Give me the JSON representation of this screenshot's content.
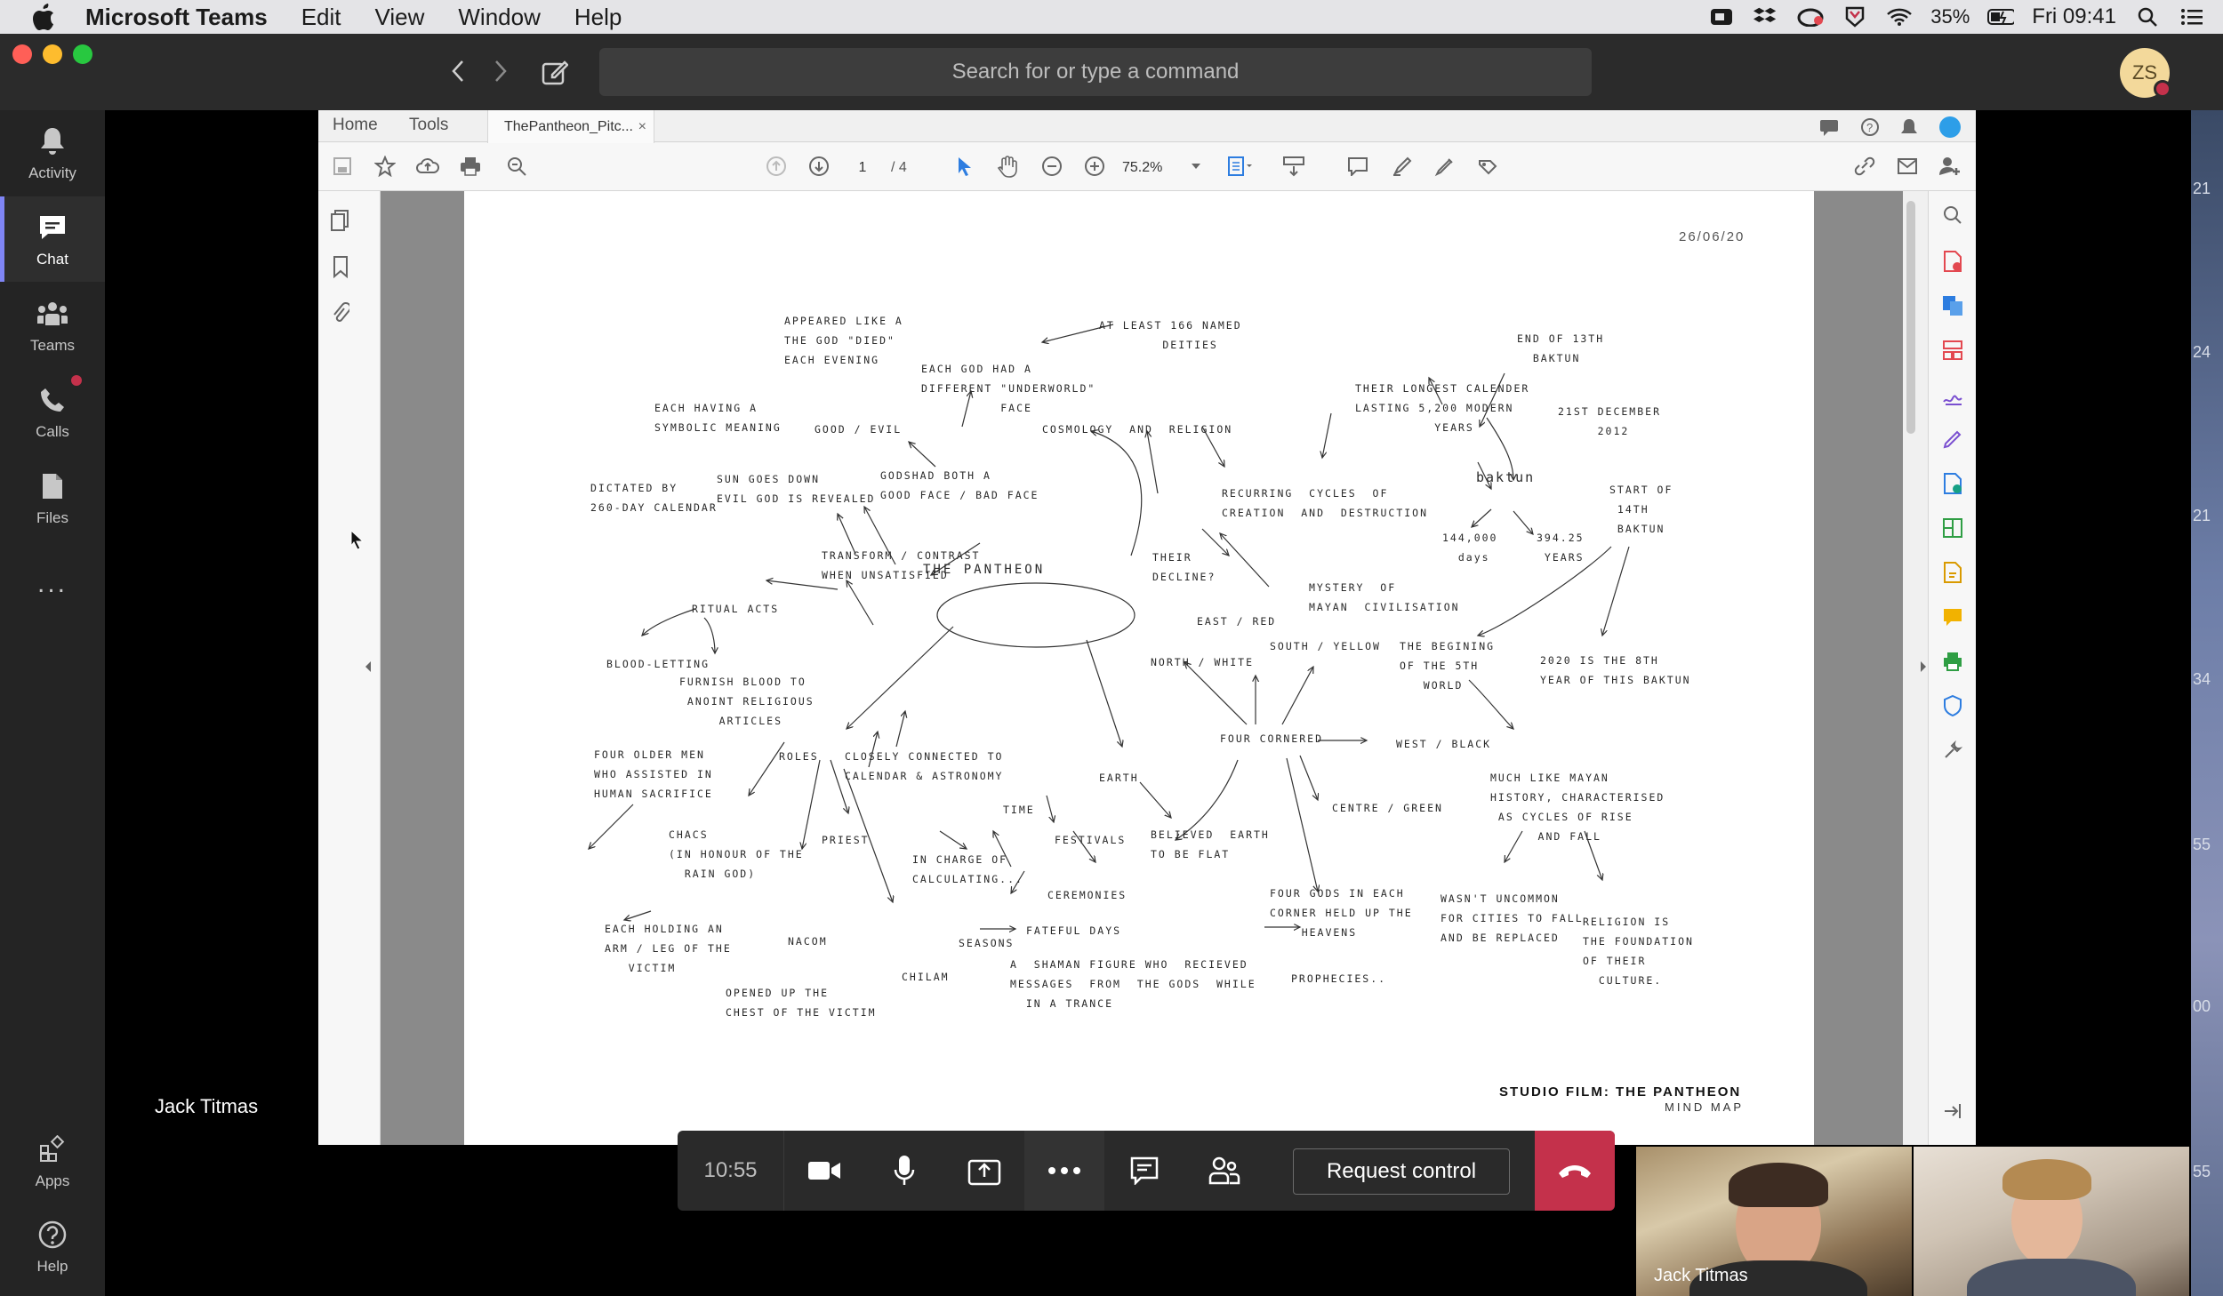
{
  "menubar": {
    "app_name": "Microsoft Teams",
    "menus": [
      "Edit",
      "View",
      "Window",
      "Help"
    ],
    "battery": "35%",
    "clock": "Fri 09:41"
  },
  "teams": {
    "search_placeholder": "Search for or type a command",
    "avatar_initials": "ZS",
    "rail": {
      "activity": "Activity",
      "chat": "Chat",
      "teams": "Teams",
      "calls": "Calls",
      "files": "Files",
      "more": "...",
      "apps": "Apps",
      "help": "Help"
    },
    "presenter_name": "Jack Titmas"
  },
  "acrobat": {
    "tabs": {
      "home": "Home",
      "tools": "Tools",
      "doc": "ThePantheon_Pitc...",
      "close": "×"
    },
    "page_current": "1",
    "page_total": "/ 4",
    "zoom": "75.2%"
  },
  "pdf": {
    "date": "26/06/20",
    "title": "STUDIO FILM: THE PANTHEON",
    "subtitle": "MIND MAP",
    "center": "THE PANTHEON",
    "nodes": {
      "n1": "APPEARED LIKE A\nTHE GOD \"DIED\"\nEACH EVENING",
      "n2": "AT LEAST 166 NAMED\n        DEITIES",
      "n3": "EACH GOD HAD A\nDIFFERENT \"UNDERWORLD\"\n          FACE",
      "n4": "EACH HAVING A\nSYMBOLIC MEANING",
      "n5": "GOOD / EVIL",
      "n6": "COSMOLOGY  AND  RELIGION",
      "n7": "SUN GOES DOWN\nEVIL GOD IS REVEALED",
      "n8": "GODSHAD BOTH A\nGOOD FACE / BAD FACE",
      "n9": "DICTATED BY\n260-DAY CALENDAR",
      "n10": "TRANSFORM / CONTRAST\nWHEN UNSATISFIED",
      "n11": "RITUAL ACTS",
      "n12": "BLOOD-LETTING",
      "n13": "FURNISH BLOOD TO\n ANOINT RELIGIOUS\n     ARTICLES",
      "n14": "END OF 13TH\n  BAKTUN",
      "n15": "THEIR LONGEST CALENDER\nLASTING 5,200 MODERN\n          YEARS",
      "n16": "21ST DECEMBER\n     2012",
      "n17": "RECURRING  CYCLES  OF\nCREATION  AND  DESTRUCTION",
      "n18": "baktun",
      "n19": "START OF\n 14TH\n BAKTUN",
      "n20": "144,000\n  days",
      "n21": "394.25\n YEARS",
      "n22": "THEIR\nDECLINE?",
      "n23": "MYSTERY  OF\nMAYAN  CIVILISATION",
      "n24": "EAST / RED",
      "n25": "SOUTH / YELLOW",
      "n26": "NORTH / WHITE",
      "n27": "THE BEGINING\nOF THE 5TH\n   WORLD",
      "n28": "2020 IS THE 8TH\nYEAR OF THIS BAKTUN",
      "n29": "FOUR CORNERED",
      "n30": "WEST / BLACK",
      "n31": "FOUR OLDER MEN\nWHO ASSISTED IN\nHUMAN SACRIFICE",
      "n32": "ROLES",
      "n33": "CLOSELY CONNECTED TO\nCALENDAR & ASTRONOMY",
      "n34": "EARTH",
      "n35": "MUCH LIKE MAYAN\nHISTORY, CHARACTERISED\n AS CYCLES OF RISE\n      AND FALL",
      "n36": "CENTRE / GREEN",
      "n37": "CHACS\n(IN HONOUR OF THE\n  RAIN GOD)",
      "n38": "PRIEST",
      "n39": "TIME",
      "n40": "FESTIVALS",
      "n41": "BELIEVED  EARTH\nTO BE FLAT",
      "n42": "IN CHARGE OF\nCALCULATING...",
      "n43": "CEREMONIES",
      "n44": "FOUR GODS IN EACH\nCORNER HELD UP THE\n    HEAVENS",
      "n45": "WASN'T UNCOMMON\nFOR CITIES TO FALL\nAND BE REPLACED",
      "n46": "RELIGION IS\nTHE FOUNDATION\nOF THEIR\n  CULTURE.",
      "n47": "EACH HOLDING AN\nARM / LEG OF THE\n   VICTIM",
      "n48": "NACOM",
      "n49": "SEASONS",
      "n50": "FATEFUL DAYS",
      "n51": "CHILAM",
      "n52": "A  SHAMAN FIGURE WHO  RECIEVED\nMESSAGES  FROM  THE GODS  WHILE\n  IN A TRANCE",
      "n53": "PROPHECIES..",
      "n54": "OPENED UP THE\nCHEST OF THE VICTIM"
    }
  },
  "call": {
    "timer": "10:55",
    "request_control": "Request control",
    "video1_name": "Jack Titmas"
  },
  "right_strip": [
    "21",
    "24",
    "21",
    "34",
    "55",
    "00",
    "55"
  ]
}
